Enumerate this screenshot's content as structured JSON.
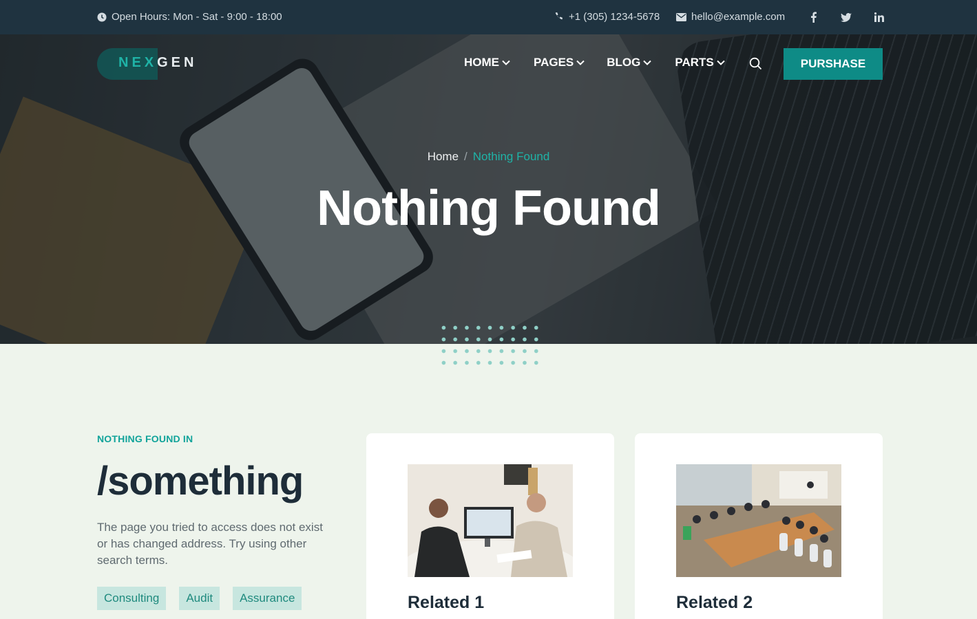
{
  "topbar": {
    "hours": "Open Hours: Mon - Sat - 9:00 - 18:00",
    "phone": "+1 (305) 1234-5678",
    "email": "hello@example.com",
    "socials": [
      "f",
      "t",
      "in"
    ]
  },
  "logo": {
    "part1": "NEX",
    "part2": "GEN"
  },
  "nav": {
    "items": [
      "HOME",
      "PAGES",
      "BLOG",
      "PARTS"
    ],
    "purchase_label": "PURSHASE"
  },
  "hero": {
    "breadcrumb": {
      "home": "Home",
      "separator": "/",
      "current": "Nothing Found"
    },
    "title": "Nothing Found"
  },
  "content": {
    "eyebrow": "NOTHING FOUND IN",
    "path": "/something",
    "description": "The page you tried to access does not exist or has changed address. Try using other search terms.",
    "tags": [
      "Consulting",
      "Audit",
      "Assurance"
    ]
  },
  "related": [
    {
      "title": "Related 1"
    },
    {
      "title": "Related 2"
    }
  ],
  "colors": {
    "accent": "#0e8b86",
    "accent_text": "#1fb3a7",
    "topbar_bg": "#1f3340",
    "page_bg": "#eef4ec",
    "heading": "#1e2d39"
  }
}
